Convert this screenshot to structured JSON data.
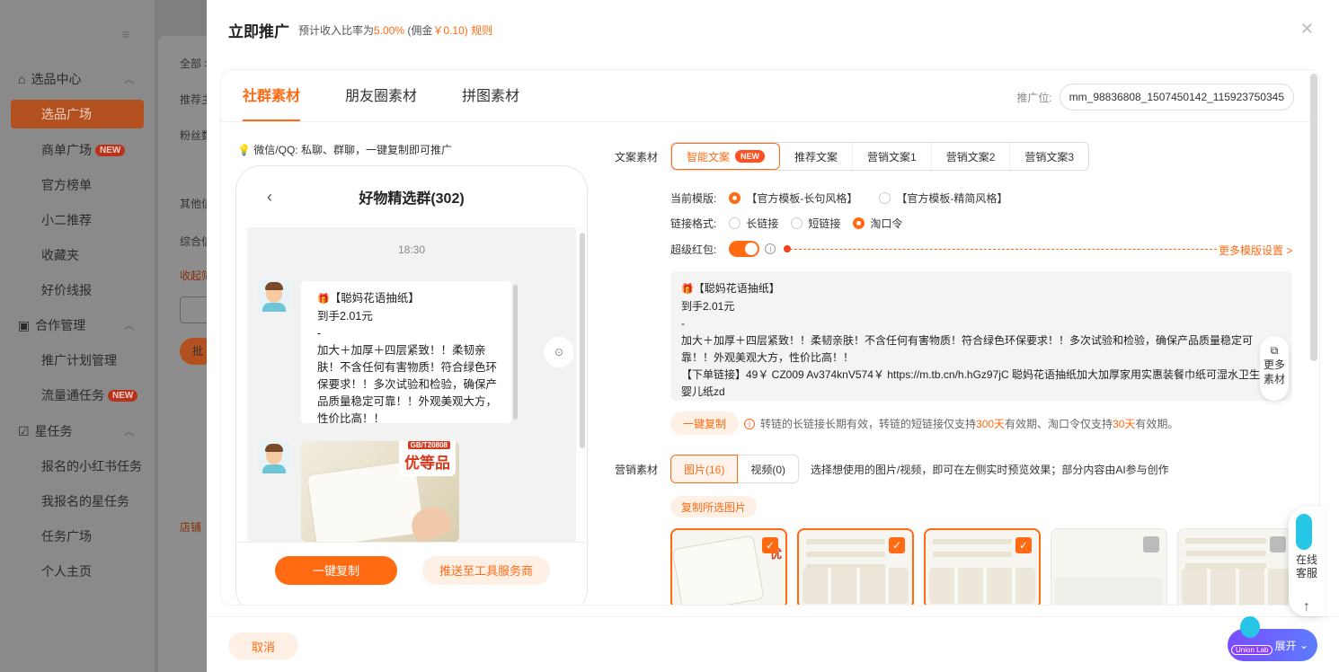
{
  "background": {
    "sidebar": {
      "menu_icon": "menu-icon",
      "groups": [
        {
          "label": "选品中心",
          "icon": "home-icon"
        },
        {
          "label": "合作管理",
          "icon": "briefcase-icon"
        },
        {
          "label": "星任务",
          "icon": "task-icon"
        }
      ],
      "items": [
        {
          "label": "选品广场",
          "active": true
        },
        {
          "label": "商单广场",
          "badge": "NEW"
        },
        {
          "label": "官方榜单"
        },
        {
          "label": "小二推荐"
        },
        {
          "label": "收藏夹"
        },
        {
          "label": "好价线报"
        },
        {
          "label": "推广计划管理"
        },
        {
          "label": "流量通任务",
          "badge": "NEW"
        },
        {
          "label": "报名的小红书任务"
        },
        {
          "label": "我报名的星任务"
        },
        {
          "label": "任务广场"
        },
        {
          "label": "个人主页"
        }
      ]
    },
    "main": {
      "labels": [
        "全部 >",
        "推荐主",
        "粉丝数",
        "其他信",
        "综合信",
        "收起筛",
        "批",
        "店铺"
      ]
    }
  },
  "drawer": {
    "title": "立即推广",
    "subtitle_prefix": "预计收入比率为",
    "rate": "5.00%",
    "commission_prefix": "(佣金",
    "commission": "￥0.10)",
    "rules_link": "规则",
    "tabs": [
      "社群素材",
      "朋友圈素材",
      "拼图素材"
    ],
    "promo_label": "推广位:",
    "promo_value": "mm_98836808_1507450142_115923750345",
    "tip": "微信/QQ: 私聊、群聊，一键复制即可推广",
    "phone": {
      "title": "好物精选群(302)",
      "time": "18:30",
      "message": {
        "title": "【聪妈花语抽纸】",
        "price": "到手2.01元",
        "dash": "-",
        "body": "加大＋加厚＋四层紧致！！柔韧亲肤！不含任何有害物质！符合绿色环保要求！！多次试验和检验，确保产品质量稳定可靠！！外观美观大方，性价比高！！"
      },
      "product_badge_top": "GB/T20808",
      "product_badge": "优等品",
      "copy_button": "一键复制",
      "push_button": "推送至工具服务商"
    },
    "copy_section": {
      "label": "文案素材",
      "tabs": [
        {
          "label": "智能文案",
          "badge": "NEW",
          "active": true
        },
        {
          "label": "推荐文案"
        },
        {
          "label": "营销文案1"
        },
        {
          "label": "营销文案2"
        },
        {
          "label": "营销文案3"
        }
      ],
      "template_label": "当前模版:",
      "template_options": [
        {
          "label": "【官方模板-长句风格】",
          "selected": true
        },
        {
          "label": "【官方模板-精简风格】",
          "selected": false
        }
      ],
      "link_label": "链接格式:",
      "link_options": [
        {
          "label": "长链接",
          "selected": false
        },
        {
          "label": "短链接",
          "selected": false
        },
        {
          "label": "淘口令",
          "selected": true
        }
      ],
      "redpack_label": "超级红包:",
      "redpack_on": true,
      "more_settings": "更多模版设置 >",
      "text": {
        "line1": "【聪妈花语抽纸】",
        "line2": "到手2.01元",
        "line3": "-",
        "line4": "加大＋加厚＋四层紧致！！柔韧亲肤！不含任何有害物质！符合绿色环保要求！！多次试验和检验，确保产品质量稳定可靠！！外观美观大方，性价比高！！",
        "line5": "【下单链接】49￥ CZ009 Av374knV574￥ https://m.tb.cn/h.hGz97jC 聪妈花语抽纸加大加厚家用实惠装餐巾纸可湿水卫生面巾婴儿纸zd"
      },
      "more_material_line1": "更多",
      "more_material_line2": "素材",
      "copy_button": "一键复制",
      "validity_prefix": "转链的长链接长期有效，转链的短链接仅支持",
      "validity_short": "300天",
      "validity_mid": "有效期、淘口令仅支持",
      "validity_tkl": "30天",
      "validity_suffix": "有效期。"
    },
    "media_section": {
      "label": "营销素材",
      "tabs": [
        {
          "label": "图片(16)",
          "active": true
        },
        {
          "label": "视频(0)",
          "active": false
        }
      ],
      "hint": "选择想使用的图片/视频，即可在左侧实时预览效果；部分内容由AI参与创作",
      "copy_selected": "复制所选图片",
      "thumbs": [
        {
          "selected": true,
          "badge": "优"
        },
        {
          "selected": true
        },
        {
          "selected": true
        },
        {
          "selected": false
        },
        {
          "selected": false
        }
      ]
    },
    "cancel_button": "取消"
  },
  "floating": {
    "service_line1": "在线",
    "service_line2": "客服",
    "union_lab_tag": "Union Lab",
    "union_lab_expand": "展开"
  },
  "colors": {
    "accent": "#ff6a13",
    "accent_soft": "#fff0e6"
  }
}
